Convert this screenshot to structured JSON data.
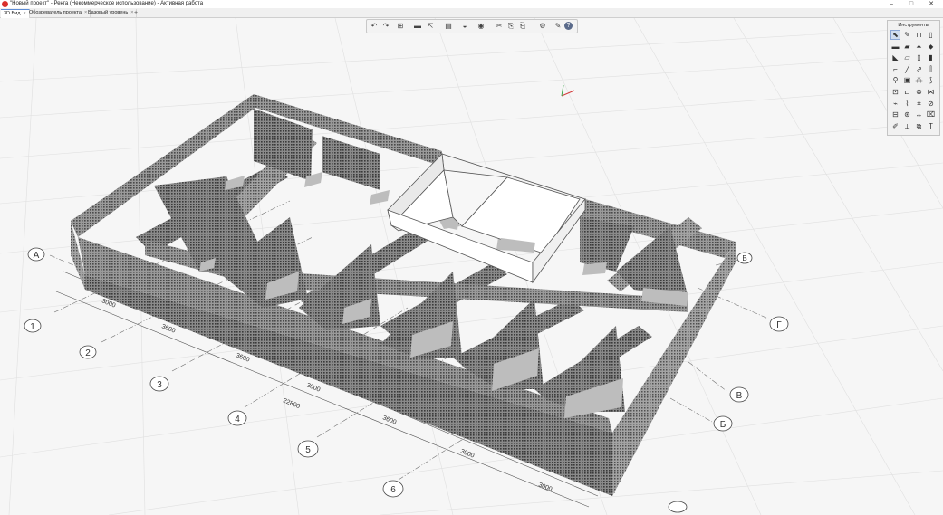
{
  "window": {
    "title": "\"Новый проект\" - Ренга (Некоммерческое использование) - Активная работа",
    "minimize": "–",
    "maximize": "□",
    "close": "✕"
  },
  "tabs": [
    {
      "label": "3D Вид",
      "close": "×"
    },
    {
      "label": "Обозреватель проекта",
      "close": "×"
    },
    {
      "label": "Базовый уровень",
      "close": "×"
    }
  ],
  "tab_add": "+",
  "toolbar": {
    "undo": "↶",
    "redo": "↷",
    "views": "⊞",
    "save": "▬",
    "export": "⇱",
    "levels": "▤",
    "layers": "◒",
    "visibility": "◉",
    "cut": "✂",
    "copy": "⎘",
    "paste": "⎗",
    "settings": "⚙",
    "tools": "✎",
    "help": "?"
  },
  "palette": {
    "title": "Инструменты",
    "tools": [
      {
        "icon": "select-icon",
        "glyph": "⬉"
      },
      {
        "icon": "brush-icon",
        "glyph": "✎"
      },
      {
        "icon": "wall-icon",
        "glyph": "⊓"
      },
      {
        "icon": "column-icon",
        "glyph": "▯"
      },
      {
        "icon": "beam-icon",
        "glyph": "▬"
      },
      {
        "icon": "slab-icon",
        "glyph": "▰"
      },
      {
        "icon": "roof-icon",
        "glyph": "⏶"
      },
      {
        "icon": "pin-icon",
        "glyph": "⬥"
      },
      {
        "icon": "plate-icon",
        "glyph": "◣"
      },
      {
        "icon": "floor-icon",
        "glyph": "▱"
      },
      {
        "icon": "door-icon",
        "glyph": "▯"
      },
      {
        "icon": "window-icon",
        "glyph": "▮"
      },
      {
        "icon": "stair-icon",
        "glyph": "⌐"
      },
      {
        "icon": "line-icon",
        "glyph": "╱"
      },
      {
        "icon": "ramp-icon",
        "glyph": "⇗"
      },
      {
        "icon": "railing-icon",
        "glyph": "⫿"
      },
      {
        "icon": "equipment-icon",
        "glyph": "⚲"
      },
      {
        "icon": "room-icon",
        "glyph": "▣"
      },
      {
        "icon": "hatch-icon",
        "glyph": "⁂"
      },
      {
        "icon": "pipe-icon",
        "glyph": "⟆"
      },
      {
        "icon": "duct-icon",
        "glyph": "⊡"
      },
      {
        "icon": "fitting-icon",
        "glyph": "⊏"
      },
      {
        "icon": "fixture-icon",
        "glyph": "⊗"
      },
      {
        "icon": "valve-icon",
        "glyph": "⋈"
      },
      {
        "icon": "route-icon",
        "glyph": "⌁"
      },
      {
        "icon": "rebar-icon",
        "glyph": "⌇"
      },
      {
        "icon": "mesh-icon",
        "glyph": "⌗"
      },
      {
        "icon": "axis-icon",
        "glyph": "⊘"
      },
      {
        "icon": "section-icon",
        "glyph": "⊟"
      },
      {
        "icon": "elevation-icon",
        "glyph": "⊛"
      },
      {
        "icon": "dimension-icon",
        "glyph": "↔"
      },
      {
        "icon": "label-icon",
        "glyph": "⌧"
      },
      {
        "icon": "note-icon",
        "glyph": "✐"
      },
      {
        "icon": "measure-icon",
        "glyph": "⟂"
      },
      {
        "icon": "model-icon",
        "glyph": "⧉"
      },
      {
        "icon": "text-icon",
        "glyph": "T"
      }
    ]
  },
  "grid_axes": {
    "numbered": [
      "1",
      "2",
      "3",
      "4",
      "5",
      "6"
    ],
    "lettered": [
      "А",
      "Б",
      "В",
      "Г"
    ],
    "top_right_marker": "В",
    "dimensions": [
      "3000",
      "3600",
      "3600",
      "3000",
      "3600",
      "3000",
      "3000"
    ],
    "total_dimension": "22800"
  },
  "colors": {
    "viewport_bg": "#f6f6f6",
    "grid_line": "#dcdcdc",
    "hatch_dark": "#3a3a3a",
    "hatch_light": "#8a8a8a",
    "white_room": "#ffffff",
    "floor_tile": "#bdbdbd",
    "axis_x": "#d33b3b",
    "axis_y": "#3ba64a",
    "tab_accent": "#5b8bd6",
    "app_icon": "#d9302c"
  }
}
